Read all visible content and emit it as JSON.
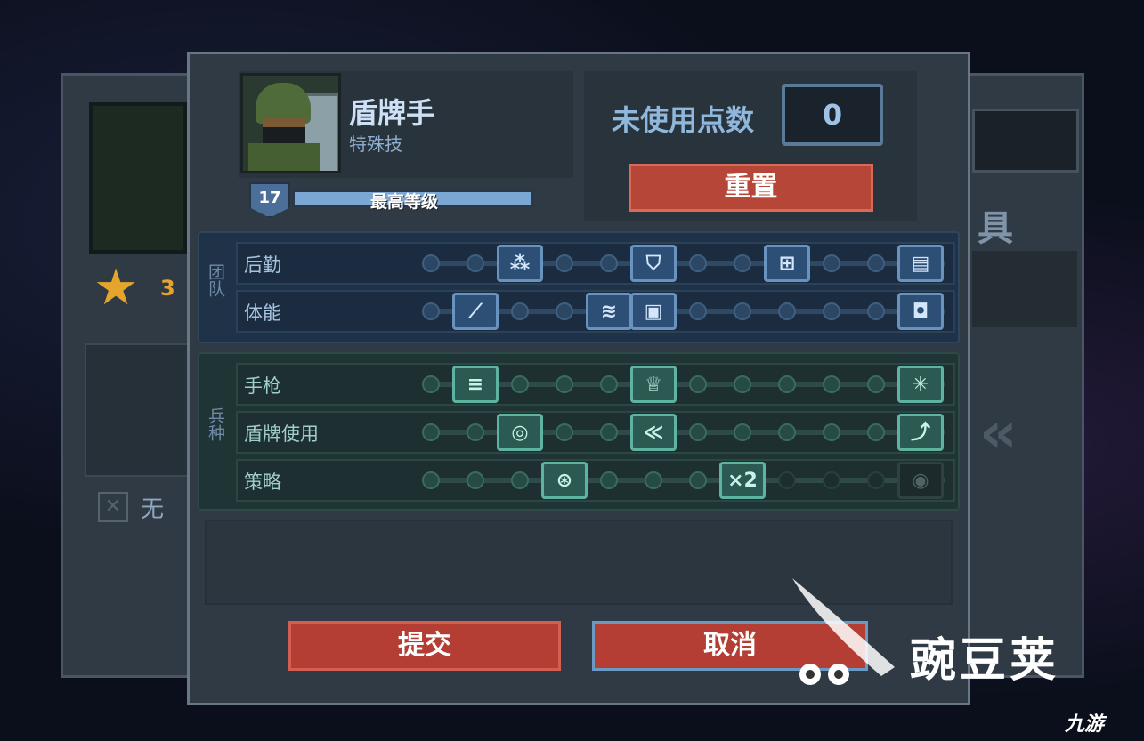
{
  "background": {
    "star_count": "3",
    "equip_none_label": "无",
    "right_partial_text": "具"
  },
  "header": {
    "class_name": "盾牌手",
    "class_subtitle": "特殊技",
    "level": "17",
    "xp_label": "最高等级",
    "xp_progress": 1.0,
    "points_label": "未使用点数",
    "points_value": "0",
    "reset_label": "重置"
  },
  "sections": {
    "team_tag": "团队",
    "arms_tag": "兵种"
  },
  "skill_rows": [
    {
      "label": "后勤",
      "section": "team",
      "slots": [
        "dot",
        "dot",
        "node:bullets-icon",
        "dot",
        "dot",
        "node:armor-plus-icon",
        "dot",
        "dot",
        "node:medkit-icon",
        "dot",
        "dot",
        "node:ammo-box-icon"
      ]
    },
    {
      "label": "体能",
      "section": "team",
      "slots": [
        "dot",
        "node:knife-icon",
        "dot",
        "dot",
        "node:sprint-icon",
        "node:crate-icon",
        "dot",
        "dot",
        "dot",
        "dot",
        "dot",
        "node:mask-icon"
      ]
    },
    {
      "label": "手枪",
      "section": "arms",
      "slots": [
        "dot",
        "node:rapid-fire-icon",
        "dot",
        "dot",
        "dot",
        "node:crown-icon",
        "dot",
        "dot",
        "dot",
        "dot",
        "dot",
        "node:burst-icon"
      ]
    },
    {
      "label": "盾牌使用",
      "section": "arms",
      "slots": [
        "dot",
        "dot",
        "node:shield-bash-icon",
        "dot",
        "dot",
        "node:chevron-swap-icon",
        "dot",
        "dot",
        "dot",
        "dot",
        "dot",
        "node:boost-icon"
      ]
    },
    {
      "label": "策略",
      "section": "arms",
      "slots": [
        "dot",
        "dot",
        "dot",
        "node:turret-icon",
        "dot",
        "dot",
        "dot",
        "node:double-icon",
        "dot:locked",
        "dot:locked",
        "dot:locked",
        "node:locked-icon"
      ]
    }
  ],
  "node_glyphs": {
    "bullets-icon": "⁂",
    "armor-plus-icon": "⛉",
    "medkit-icon": "⊞",
    "ammo-box-icon": "▤",
    "knife-icon": "⟋",
    "sprint-icon": "≋",
    "crate-icon": "▣",
    "mask-icon": "◘",
    "rapid-fire-icon": "≡",
    "crown-icon": "♕",
    "burst-icon": "✳",
    "shield-bash-icon": "◎",
    "chevron-swap-icon": "≪",
    "boost-icon": "⤴",
    "turret-icon": "⊛",
    "double-icon": "×2",
    "locked-icon": "◉"
  },
  "buttons": {
    "submit": "提交",
    "cancel": "取消"
  },
  "watermarks": {
    "main": "豌豆荚",
    "corner": "九游"
  },
  "colors": {
    "reset_button": "#b64638",
    "team_node": "#6893bf",
    "arms_node": "#5fb3a1",
    "star": "#e5a52a"
  }
}
